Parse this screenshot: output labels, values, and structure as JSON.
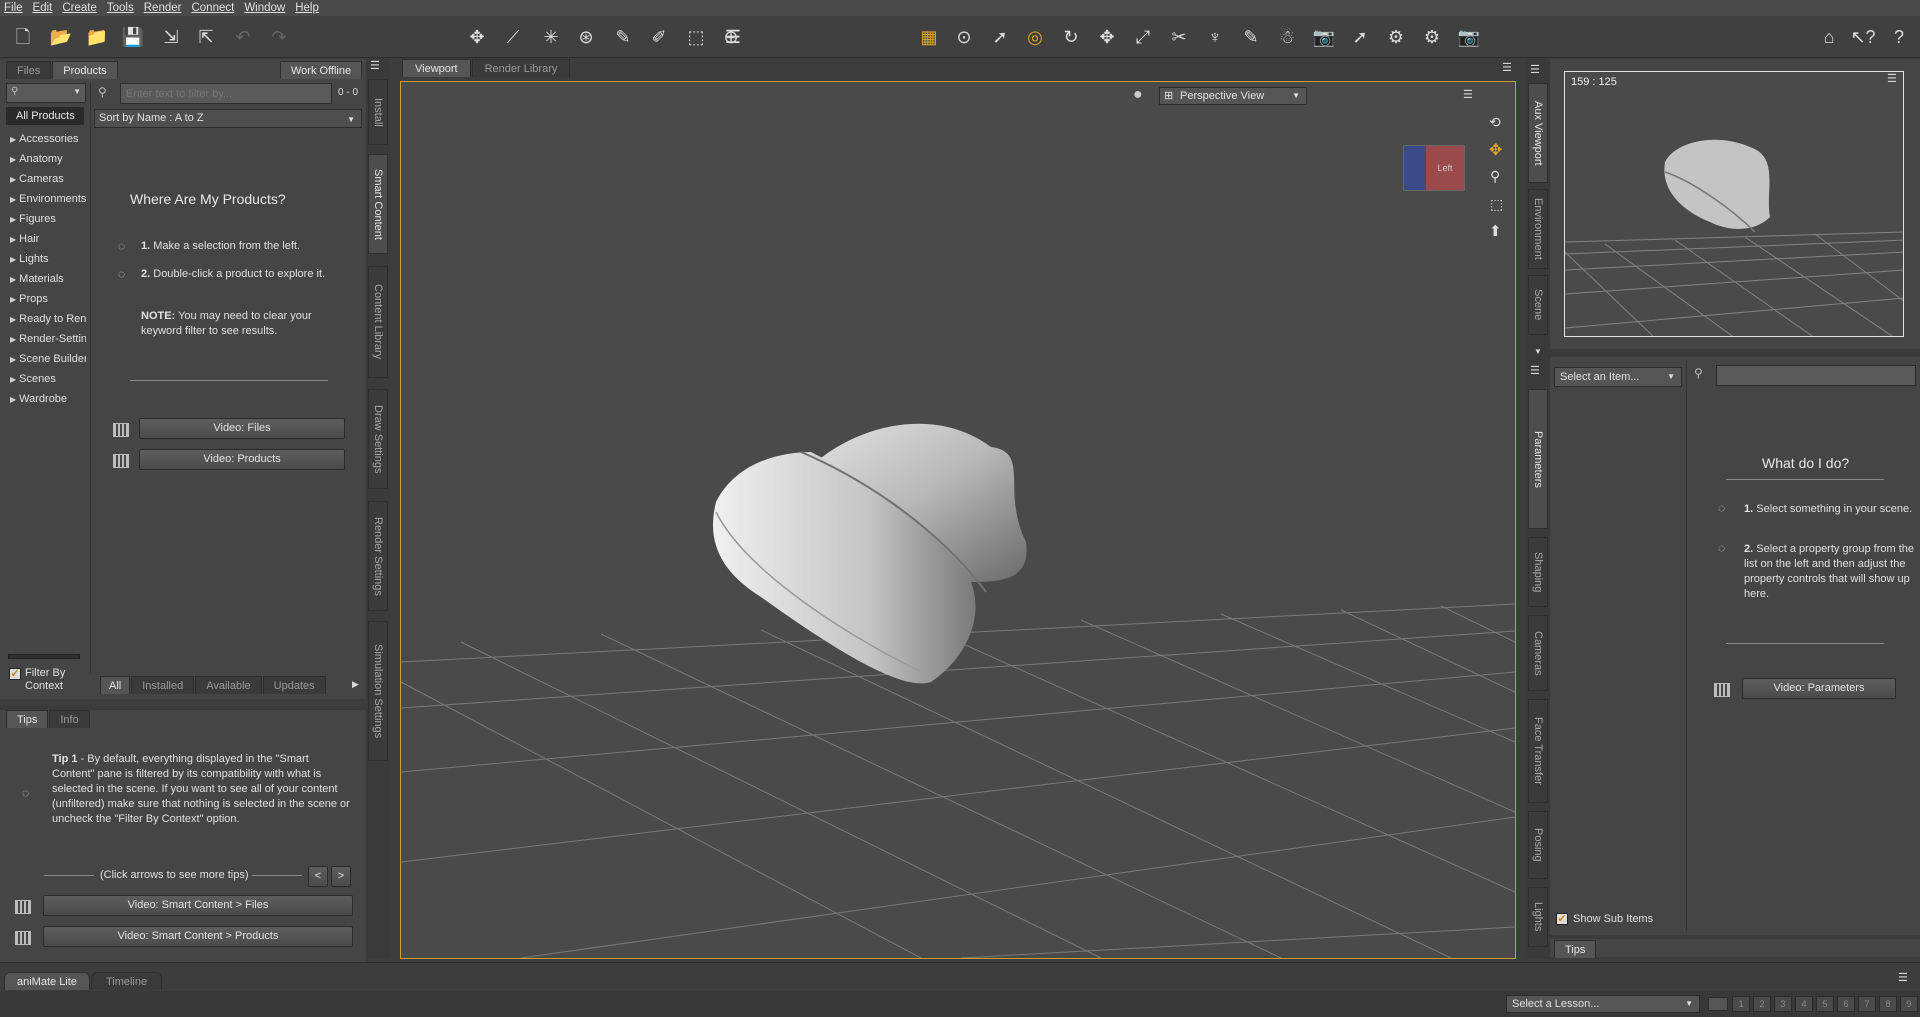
{
  "menu": [
    "File",
    "Edit",
    "Create",
    "Tools",
    "Render",
    "Connect",
    "Window",
    "Help"
  ],
  "left_panel": {
    "tabs": {
      "files": "Files",
      "products": "Products",
      "work_offline": "Work Offline"
    },
    "filter_placeholder": "Enter text to filter by...",
    "filter_count": "0 - 0",
    "sort_label": "Sort by Name : A to Z",
    "all_products": "All Products",
    "categories": [
      "Accessories",
      "Anatomy",
      "Cameras",
      "Environments",
      "Figures",
      "Hair",
      "Lights",
      "Materials",
      "Props",
      "Ready to Rend",
      "Render-Settin",
      "Scene Builder",
      "Scenes",
      "Wardrobe"
    ],
    "help_title": "Where Are My Products?",
    "step1_num": "1.",
    "step1_text": "Make a selection from the left.",
    "step2_num": "2.",
    "step2_text": "Double-click a product to explore it.",
    "note_bold": "NOTE:",
    "note_text": "You may need to clear your keyword filter to see results.",
    "video_files": "Video: Files",
    "video_products": "Video: Products",
    "filter_by_context": "Filter By Context",
    "bottom_tabs": [
      "All",
      "Installed",
      "Available",
      "Updates"
    ]
  },
  "side_tabs_left": [
    "Install",
    "Smart Content",
    "Content Library",
    "Draw Settings",
    "Render Settings",
    "Simulation Settings"
  ],
  "tips_panel": {
    "tabs": {
      "tips": "Tips",
      "info": "Info"
    },
    "tip_bold": "Tip 1",
    "tip_text": " - By default, everything displayed in the \"Smart Content\" pane is filtered by its compatibility with what is selected in the scene. If you want to see all of your content (unfiltered) make sure that nothing is selected in the scene or uncheck the \"Filter By Context\" option.",
    "more_tips": "(Click arrows to see more tips)",
    "prev": "<",
    "next": ">",
    "video_sc_files": "Video: Smart Content > Files",
    "video_sc_products": "Video: Smart Content > Products"
  },
  "viewport": {
    "tabs": {
      "viewport": "Viewport",
      "render_library": "Render Library"
    },
    "view_label": "Perspective View",
    "cube_label": "Left"
  },
  "aux": {
    "coords": "159 : 125",
    "side_tabs": [
      "Aux Viewport",
      "Environment",
      "Scene"
    ]
  },
  "params": {
    "side_tabs": [
      "Parameters",
      "Shaping",
      "Cameras",
      "Face Transfer",
      "Posing",
      "Lights"
    ],
    "select_item": "Select an Item...",
    "title": "What do I do?",
    "step1_num": "1.",
    "step1_text": "Select something in your scene.",
    "step2_num": "2.",
    "step2_text": "Select a property group from the list on the left and then adjust the property controls that will show up here.",
    "video": "Video: Parameters",
    "show_sub_items": "Show Sub Items",
    "tips_tab": "Tips"
  },
  "timeline": {
    "tabs": {
      "animate": "aniMate Lite",
      "timeline": "Timeline"
    },
    "select_lesson": "Select a Lesson...",
    "pages": [
      "1",
      "2",
      "3",
      "4",
      "5",
      "6",
      "7",
      "8",
      "9"
    ]
  },
  "colors": {
    "accent": "#e2a626",
    "viewport_bg": "#4a4a4a",
    "panel": "#454545"
  }
}
